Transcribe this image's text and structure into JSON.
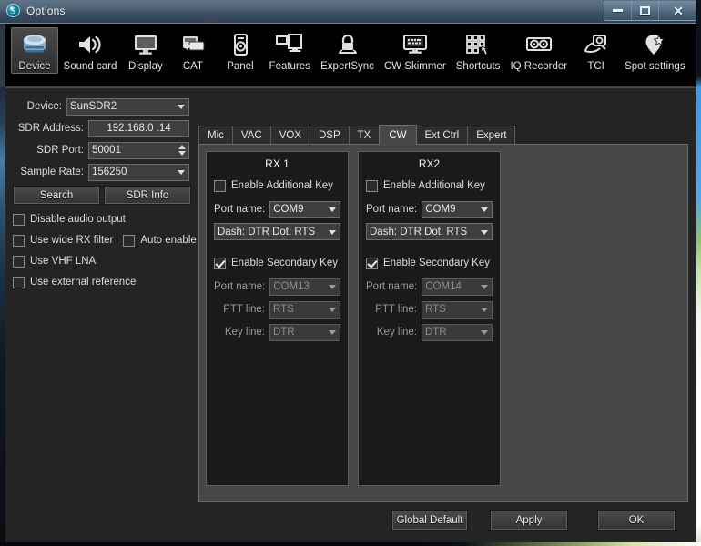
{
  "window": {
    "title": "Options",
    "app_icon": "app-logo-icon",
    "buttons": {
      "minimize": "minimize",
      "maximize": "maximize",
      "close": "close"
    }
  },
  "toolbar": {
    "items": [
      {
        "label": "Device",
        "icon": "device-icon",
        "active": true
      },
      {
        "label": "Sound card",
        "icon": "speaker-icon",
        "active": false
      },
      {
        "label": "Display",
        "icon": "monitor-icon",
        "active": false
      },
      {
        "label": "CAT",
        "icon": "cat-transfer-icon",
        "active": false
      },
      {
        "label": "Panel",
        "icon": "panel-device-icon",
        "active": false
      },
      {
        "label": "Features",
        "icon": "two-screens-icon",
        "active": false
      },
      {
        "label": "ExpertSync",
        "icon": "lock-icon",
        "active": false
      },
      {
        "label": "CW Skimmer",
        "icon": "skimmer-monitor-icon",
        "active": false
      },
      {
        "label": "Shortcuts",
        "icon": "keypad-hand-icon",
        "active": false
      },
      {
        "label": "IQ Recorder",
        "icon": "tape-reel-icon",
        "active": false
      },
      {
        "label": "TCI",
        "icon": "tci-plug-icon",
        "active": false
      },
      {
        "label": "Spot settings",
        "icon": "map-pin-star-icon",
        "active": false
      }
    ]
  },
  "device_panel": {
    "fields": [
      {
        "label": "Device:",
        "value": "SunSDR2",
        "type": "combo"
      },
      {
        "label": "SDR Address:",
        "value": "192.168.0  .14",
        "type": "text"
      },
      {
        "label": "SDR Port:",
        "value": "50001",
        "type": "spin"
      },
      {
        "label": "Sample Rate:",
        "value": "156250",
        "type": "combo"
      }
    ],
    "buttons": [
      {
        "label": "Search"
      },
      {
        "label": "SDR Info"
      }
    ],
    "checkboxes": [
      {
        "label": "Disable audio output",
        "checked": false,
        "disabled": false
      },
      {
        "label": "Use wide RX filter",
        "checked": false,
        "disabled": false
      },
      {
        "label": "Auto enable",
        "checked": false,
        "disabled": false
      },
      {
        "label": "Use VHF LNA",
        "checked": false,
        "disabled": false
      },
      {
        "label": "Use external reference",
        "checked": false,
        "disabled": false
      }
    ]
  },
  "tabs": [
    {
      "label": "Mic",
      "active": false
    },
    {
      "label": "VAC",
      "active": false
    },
    {
      "label": "VOX",
      "active": false
    },
    {
      "label": "DSP",
      "active": false
    },
    {
      "label": "TX",
      "active": false
    },
    {
      "label": "CW",
      "active": true
    },
    {
      "label": "Ext Ctrl",
      "active": false
    },
    {
      "label": "Expert",
      "active": false
    }
  ],
  "cw_tab": {
    "rx1": {
      "title": "RX 1",
      "additional_key": {
        "label": "Enable Additional Key",
        "checked": false,
        "port_label": "Port name:",
        "port_value": "COM9",
        "line_value": "Dash: DTR    Dot: RTS"
      },
      "secondary_key": {
        "label": "Enable Secondary Key",
        "checked": true,
        "port_label": "Port name:",
        "port_value": "COM13",
        "ptt_label": "PTT line:",
        "ptt_value": "RTS",
        "key_label": "Key line:",
        "key_value": "DTR"
      }
    },
    "rx2": {
      "title": "RX2",
      "additional_key": {
        "label": "Enable Additional Key",
        "checked": false,
        "port_label": "Port name:",
        "port_value": "COM9",
        "line_value": "Dash: DTR    Dot: RTS"
      },
      "secondary_key": {
        "label": "Enable Secondary Key",
        "checked": true,
        "port_label": "Port name:",
        "port_value": "COM14",
        "ptt_label": "PTT line:",
        "ptt_value": "RTS",
        "key_label": "Key line:",
        "key_value": "DTR"
      }
    }
  },
  "footer": {
    "global_default": "Global Default",
    "apply": "Apply",
    "ok": "OK"
  },
  "colors": {
    "window_bg": "#242424",
    "toolbar_bg": "#000000",
    "panel_bg": "#474747",
    "group_bg": "#1a1a1a",
    "accent_title": "#6e8498",
    "text": "#e4e4e4",
    "text_disabled": "#8e8e8e"
  }
}
